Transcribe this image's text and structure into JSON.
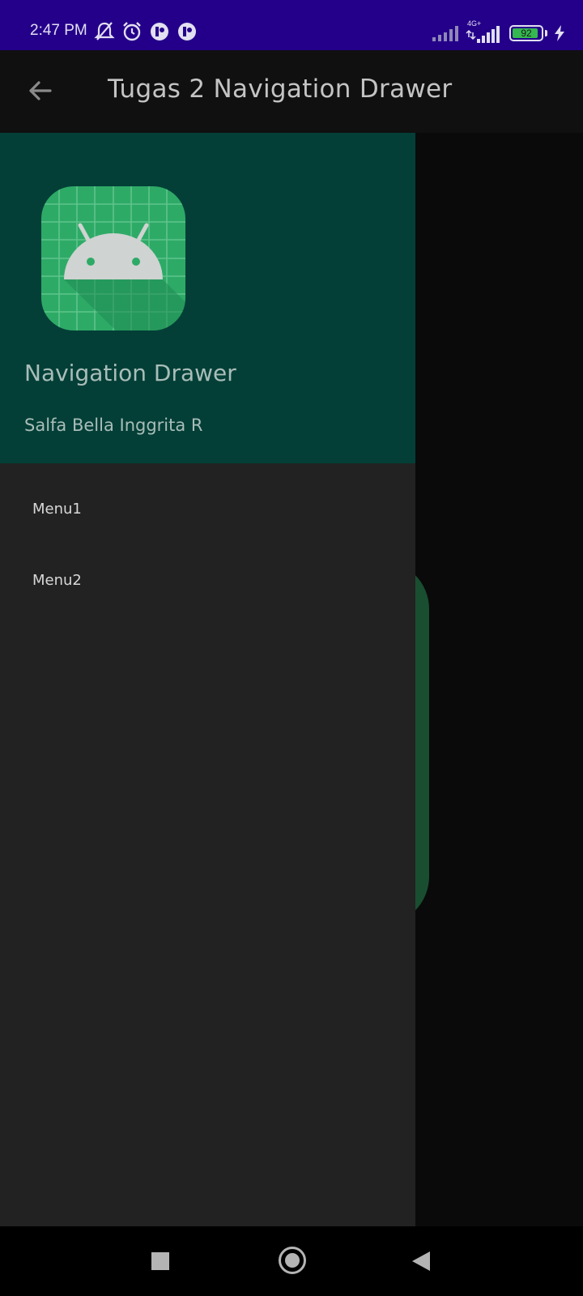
{
  "status_bar": {
    "time": "2:47 PM",
    "left_icons": [
      "mute-bell-icon",
      "alarm-icon",
      "app-notification-icon",
      "app-notification-icon"
    ],
    "network_label": "4G+",
    "battery_level": "92",
    "charging": true,
    "bg_color": "#24008a"
  },
  "app_bar": {
    "title": "Tugas 2 Navigation Drawer",
    "back_icon": "arrow-back-icon"
  },
  "drawer": {
    "header": {
      "icon": "android-app-icon",
      "title": "Navigation Drawer",
      "subtitle": "Salfa Bella Inggrita R",
      "bg_color": "#033f37"
    },
    "menu_items": [
      {
        "label": "Menu1"
      },
      {
        "label": "Menu2"
      }
    ]
  },
  "nav_bar": {
    "buttons": [
      "recent-apps-icon",
      "home-icon",
      "back-triangle-icon"
    ]
  }
}
